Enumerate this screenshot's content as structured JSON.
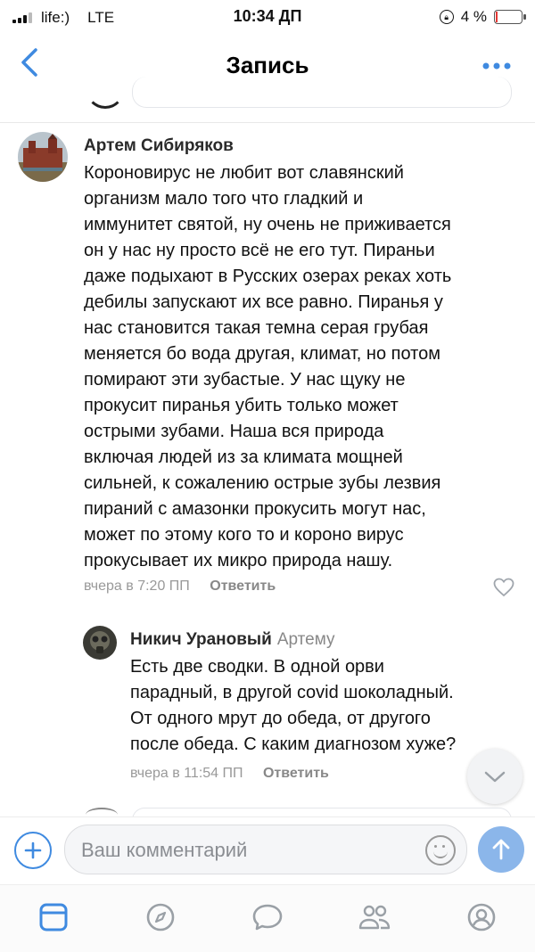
{
  "status_bar": {
    "carrier": "life:)",
    "network": "LTE",
    "time": "10:34 ДП",
    "battery_percent": "4 %",
    "battery_level": 0.04
  },
  "header": {
    "title": "Запись",
    "back_icon": "chevron-left-icon",
    "more_icon": "more-dots-icon"
  },
  "comments": [
    {
      "author": "Артем Сибиряков",
      "text_lines": [
        "Короновирус не любит вот славянский",
        "организм мало того что гладкий и",
        "иммунитет святой, ну очень не приживается",
        "он у нас ну просто всё не его тут. Пираньи",
        "даже подыхают в Русских озерах реках хоть",
        "дебилы запускают их все равно. Пиранья у",
        "нас становится такая темна серая грубая",
        "меняется бо вода другая, климат, но потом",
        "помирают эти зубастые. У нас щуку не",
        "прокусит пиранья убить только может",
        "острыми зубами. Наша вся природа",
        "включая людей из за климата мощней",
        "сильней, к сожалению острые зубы лезвия",
        "пираний с амазонки прокусить могут нас,",
        "может по этому кого то и короно вирус",
        "прокусывает их микро природа нашу."
      ],
      "time": "вчера в 7:20 ПП",
      "reply_label": "Ответить",
      "like_icon": "heart-icon"
    },
    {
      "author": "Никич Урановый",
      "reply_to": "Артему",
      "text_lines": [
        "Есть две сводки. В одной орви",
        "парадный, в другой covid шоколадный.",
        "От одного мрут до обеда, от другого",
        "после обеда. С каким диагнозом хуже?"
      ],
      "time": "вчера в 11:54 ПП",
      "reply_label": "Ответить"
    }
  ],
  "composer": {
    "placeholder": "Ваш комментарий",
    "add_icon": "plus-icon",
    "emoji_icon": "smile-icon",
    "send_icon": "arrow-up-icon"
  },
  "tabbar": {
    "items": [
      "news-icon",
      "compass-icon",
      "messages-icon",
      "friends-icon",
      "profile-icon"
    ]
  },
  "colors": {
    "accent": "#3f8ae0",
    "send_button": "#8bb6ea",
    "muted_text": "#999999"
  }
}
